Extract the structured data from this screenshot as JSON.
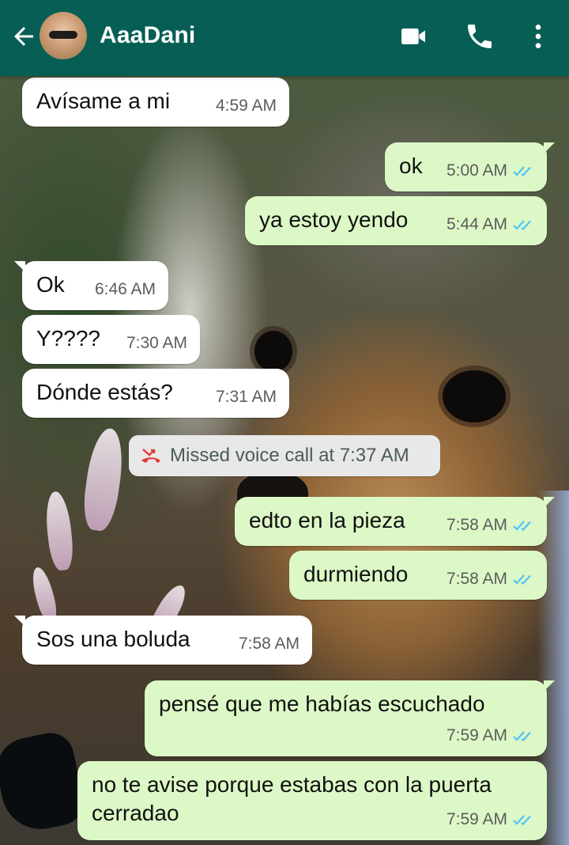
{
  "header": {
    "contact_name": "AaaDani",
    "back_icon": "back-arrow-icon",
    "video_icon": "video-call-icon",
    "voice_icon": "voice-call-icon",
    "menu_icon": "more-options-icon",
    "color": "#075e54"
  },
  "colors": {
    "incoming_bubble": "#ffffff",
    "outgoing_bubble": "#dcf8c6",
    "read_ticks": "#4fc3f7",
    "missed_call_icon": "#e53935"
  },
  "messages": [
    {
      "dir": "in",
      "text": "Avísame a mi",
      "time": "4:59 AM"
    },
    {
      "dir": "out",
      "text": "ok",
      "time": "5:00 AM",
      "status": "read"
    },
    {
      "dir": "out",
      "text": "ya estoy yendo",
      "time": "5:44 AM",
      "status": "read"
    },
    {
      "dir": "in",
      "text": "Ok",
      "time": "6:46 AM"
    },
    {
      "dir": "in",
      "text": "Y????",
      "time": "7:30 AM"
    },
    {
      "dir": "in",
      "text": "Dónde estás?",
      "time": "7:31 AM"
    },
    {
      "dir": "out",
      "text": "edto en la pieza",
      "time": "7:58 AM",
      "status": "read"
    },
    {
      "dir": "out",
      "text": "durmiendo",
      "time": "7:58 AM",
      "status": "read"
    },
    {
      "dir": "in",
      "text": "Sos una boluda",
      "time": "7:58 AM"
    },
    {
      "dir": "out",
      "text": "pensé que me habías escuchado",
      "time": "7:59 AM",
      "status": "read"
    },
    {
      "dir": "out",
      "text": "no te avise porque estabas con la puerta cerradao",
      "time": "7:59 AM",
      "status": "read"
    }
  ],
  "system_message": {
    "icon": "missed-call-icon",
    "text": "Missed voice call at 7:37 AM"
  }
}
